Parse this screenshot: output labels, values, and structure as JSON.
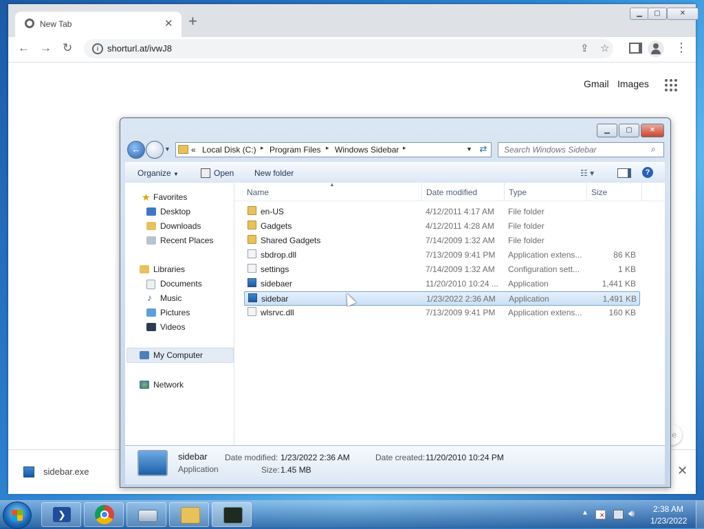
{
  "browser": {
    "tab_title": "New Tab",
    "url": "shorturl.at/ivwJ8",
    "ntp_links": [
      "Gmail",
      "Images"
    ],
    "download_file": "sidebar.exe",
    "customize_fragment": "e"
  },
  "explorer": {
    "address": [
      "Local Disk (C:)",
      "Program Files",
      "Windows Sidebar"
    ],
    "address_prefix": "«",
    "search_placeholder": "Search Windows Sidebar",
    "commands": {
      "organize": "Organize",
      "open": "Open",
      "new_folder": "New folder"
    },
    "nav": {
      "favorites": "Favorites",
      "favorites_items": [
        "Desktop",
        "Downloads",
        "Recent Places"
      ],
      "libraries": "Libraries",
      "libraries_items": [
        "Documents",
        "Music",
        "Pictures",
        "Videos"
      ],
      "computer": "My Computer",
      "network": "Network"
    },
    "columns": [
      "Name",
      "Date modified",
      "Type",
      "Size"
    ],
    "files": [
      {
        "name": "en-US",
        "date": "4/12/2011 4:17 AM",
        "type": "File folder",
        "size": "",
        "icon": "folder"
      },
      {
        "name": "Gadgets",
        "date": "4/12/2011 4:28 AM",
        "type": "File folder",
        "size": "",
        "icon": "folder"
      },
      {
        "name": "Shared Gadgets",
        "date": "7/14/2009 1:32 AM",
        "type": "File folder",
        "size": "",
        "icon": "folder"
      },
      {
        "name": "sbdrop.dll",
        "date": "7/13/2009 9:41 PM",
        "type": "Application extens...",
        "size": "86 KB",
        "icon": "dll"
      },
      {
        "name": "settings",
        "date": "7/14/2009 1:32 AM",
        "type": "Configuration sett...",
        "size": "1 KB",
        "icon": "cfg"
      },
      {
        "name": "sidebaer",
        "date": "11/20/2010 10:24 ...",
        "type": "Application",
        "size": "1,441 KB",
        "icon": "app"
      },
      {
        "name": "sidebar",
        "date": "1/23/2022 2:36 AM",
        "type": "Application",
        "size": "1,491 KB",
        "icon": "app",
        "selected": true
      },
      {
        "name": "wlsrvc.dll",
        "date": "7/13/2009 9:41 PM",
        "type": "Application extens...",
        "size": "160 KB",
        "icon": "dll"
      }
    ],
    "details": {
      "name": "sidebar",
      "type": "Application",
      "modified_label": "Date modified:",
      "modified": "1/23/2022 2:36 AM",
      "created_label": "Date created:",
      "created": "11/20/2010 10:24 PM",
      "size_label": "Size:",
      "size": "1.45 MB"
    }
  },
  "taskbar": {
    "time": "2:38 AM",
    "date": "1/23/2022"
  }
}
